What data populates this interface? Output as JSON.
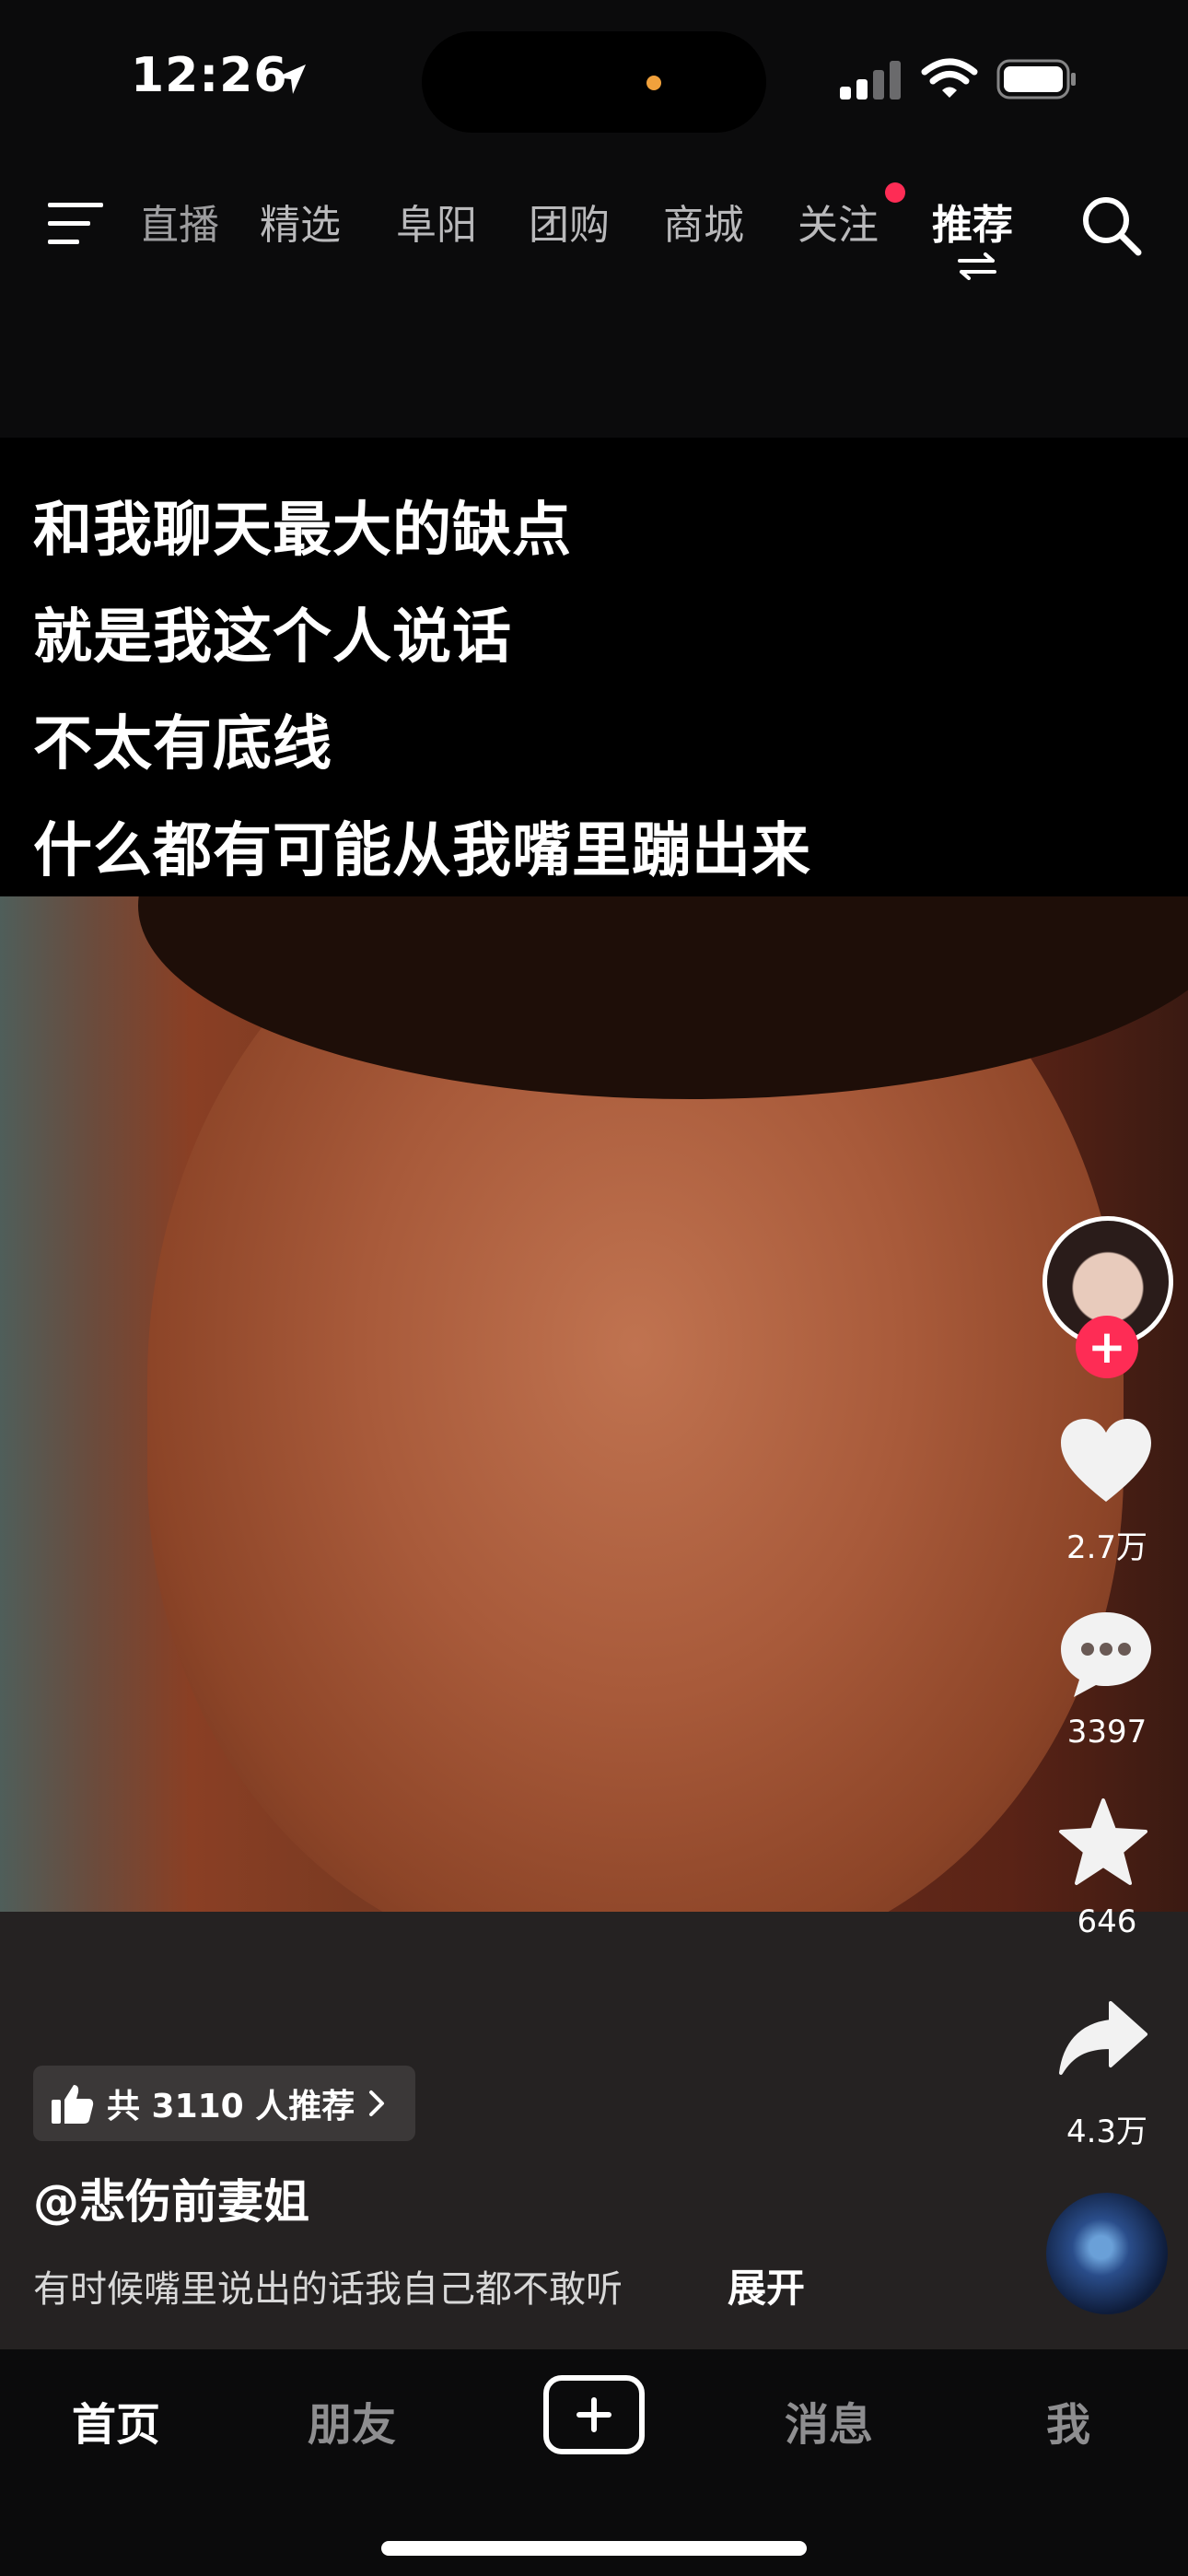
{
  "status_bar": {
    "time": "12:26"
  },
  "top_nav": {
    "tabs": [
      {
        "label": "直播"
      },
      {
        "label": "精选"
      },
      {
        "label": "阜阳"
      },
      {
        "label": "团购"
      },
      {
        "label": "商城"
      },
      {
        "label": "关注"
      },
      {
        "label": "推荐"
      }
    ],
    "active_tab": "推荐"
  },
  "video": {
    "caption_lines": [
      "和我聊天最大的缺点",
      "就是我这个人说话",
      "不太有底线",
      "什么都有可能从我嘴里蹦出来"
    ]
  },
  "actions": {
    "likes": "2.7万",
    "comments": "3397",
    "favorites": "646",
    "shares": "4.3万"
  },
  "post": {
    "recommend_text": "共 3110 人推荐",
    "author": "@悲伤前妻姐",
    "description": "有时候嘴里说出的话我自己都不敢听",
    "expand_label": "展开"
  },
  "bottom_tabs": {
    "home": "首页",
    "friends": "朋友",
    "messages": "消息",
    "me": "我"
  },
  "colors": {
    "accent_red": "#fe2c55",
    "background": "#0b0b0c",
    "info_panel": "#252222"
  }
}
